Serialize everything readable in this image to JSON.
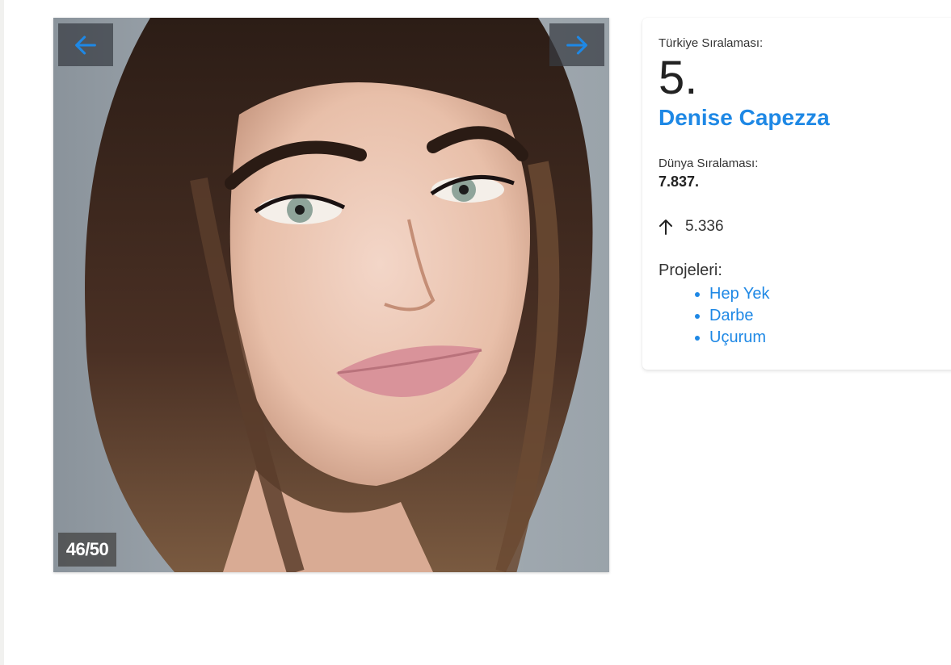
{
  "gallery": {
    "counter": "46/50",
    "prev_icon": "arrow-left-icon",
    "next_icon": "arrow-right-icon",
    "accent_color": "#1e88e5"
  },
  "profile": {
    "turkey_rank_label": "Türkiye Sıralaması:",
    "turkey_rank": "5.",
    "name": "Denise Capezza",
    "world_rank_label": "Dünya Sıralaması:",
    "world_rank": "7.837.",
    "change_icon": "arrow-up-icon",
    "change": "5.336",
    "projects_label": "Projeleri:",
    "projects": [
      "Hep Yek",
      "Darbe",
      "Uçurum"
    ]
  }
}
